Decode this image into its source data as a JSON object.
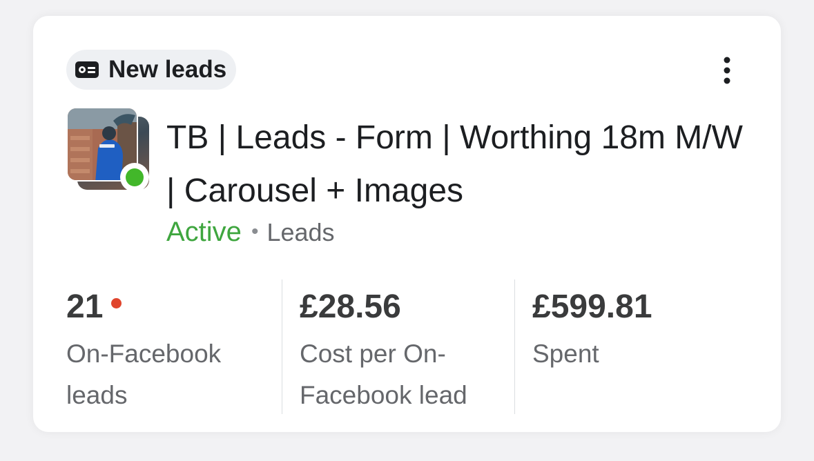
{
  "badge": {
    "icon": "lead-form-icon",
    "label": "New leads"
  },
  "menu": {
    "icon": "more-vertical-icon"
  },
  "campaign": {
    "title": "TB | Leads - Form | Worthing 18m M/W | Carousel + Images",
    "status": "Active",
    "separator": "•",
    "objective": "Leads",
    "status_color": "#42b72a"
  },
  "metrics": [
    {
      "value": "21",
      "label": "On-Facebook leads",
      "has_alert_dot": true
    },
    {
      "value": "£28.56",
      "label": "Cost per On-Facebook lead",
      "has_alert_dot": false
    },
    {
      "value": "£599.81",
      "label": "Spent",
      "has_alert_dot": false
    }
  ],
  "colors": {
    "active_text": "#3fa63f",
    "alert_dot": "#e0452d",
    "primary_text": "#1c1e21",
    "secondary_text": "#65676b"
  }
}
